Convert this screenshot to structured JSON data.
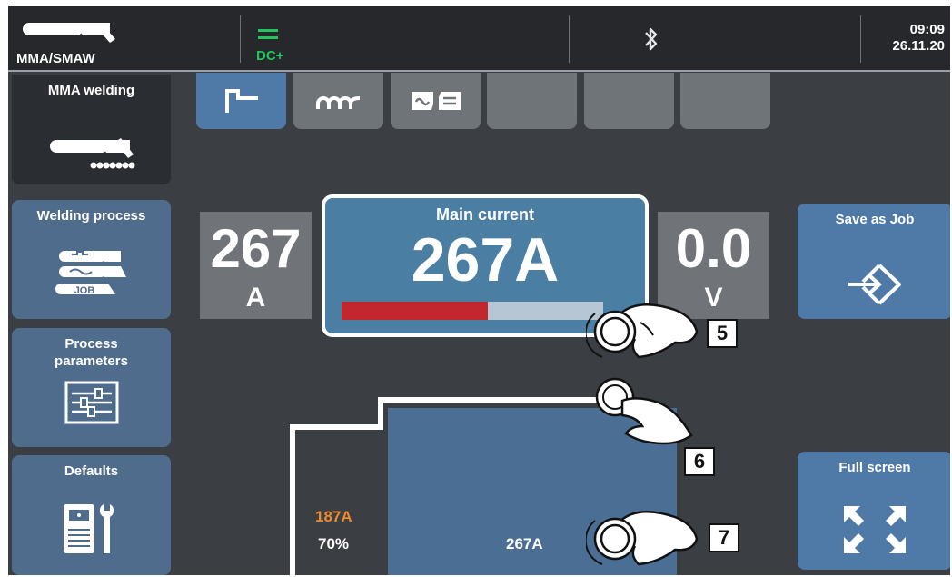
{
  "topbar": {
    "mode": "MMA/SMAW",
    "polarity": "DC+",
    "bluetooth_icon": "bluetooth-icon",
    "time": "09:09",
    "date": "26.11.20"
  },
  "sidebar": {
    "items": [
      {
        "label": "MMA welding",
        "icon": "electrode-holder-icon"
      },
      {
        "label": "Welding process",
        "icon": "process-job-icon"
      },
      {
        "label": "Process parameters",
        "icon": "sliders-icon"
      },
      {
        "label": "Defaults",
        "icon": "machine-wrench-icon"
      }
    ]
  },
  "tabs": [
    {
      "icon": "hot-start-icon",
      "active": true
    },
    {
      "icon": "arc-force-icon",
      "active": false
    },
    {
      "icon": "ac-dc-icon",
      "active": false
    },
    {
      "icon": "",
      "active": false
    },
    {
      "icon": "",
      "active": false
    },
    {
      "icon": "",
      "active": false
    }
  ],
  "readouts": {
    "left_value": "267",
    "left_unit": "A",
    "main_title": "Main current",
    "main_value": "267A",
    "main_bar_fraction": 0.56,
    "right_value": "0.0",
    "right_unit": "V"
  },
  "buttons": {
    "save_job": "Save as Job",
    "full_screen": "Full screen"
  },
  "graph": {
    "start_current": "187A",
    "start_percent": "70%",
    "main_current": "267A"
  },
  "callouts": [
    "5",
    "6",
    "7"
  ],
  "colors": {
    "accent": "#4f7aa8",
    "dc_green": "#22c55e",
    "bar_red": "#c1272d",
    "start_orange": "#f08a2a"
  }
}
